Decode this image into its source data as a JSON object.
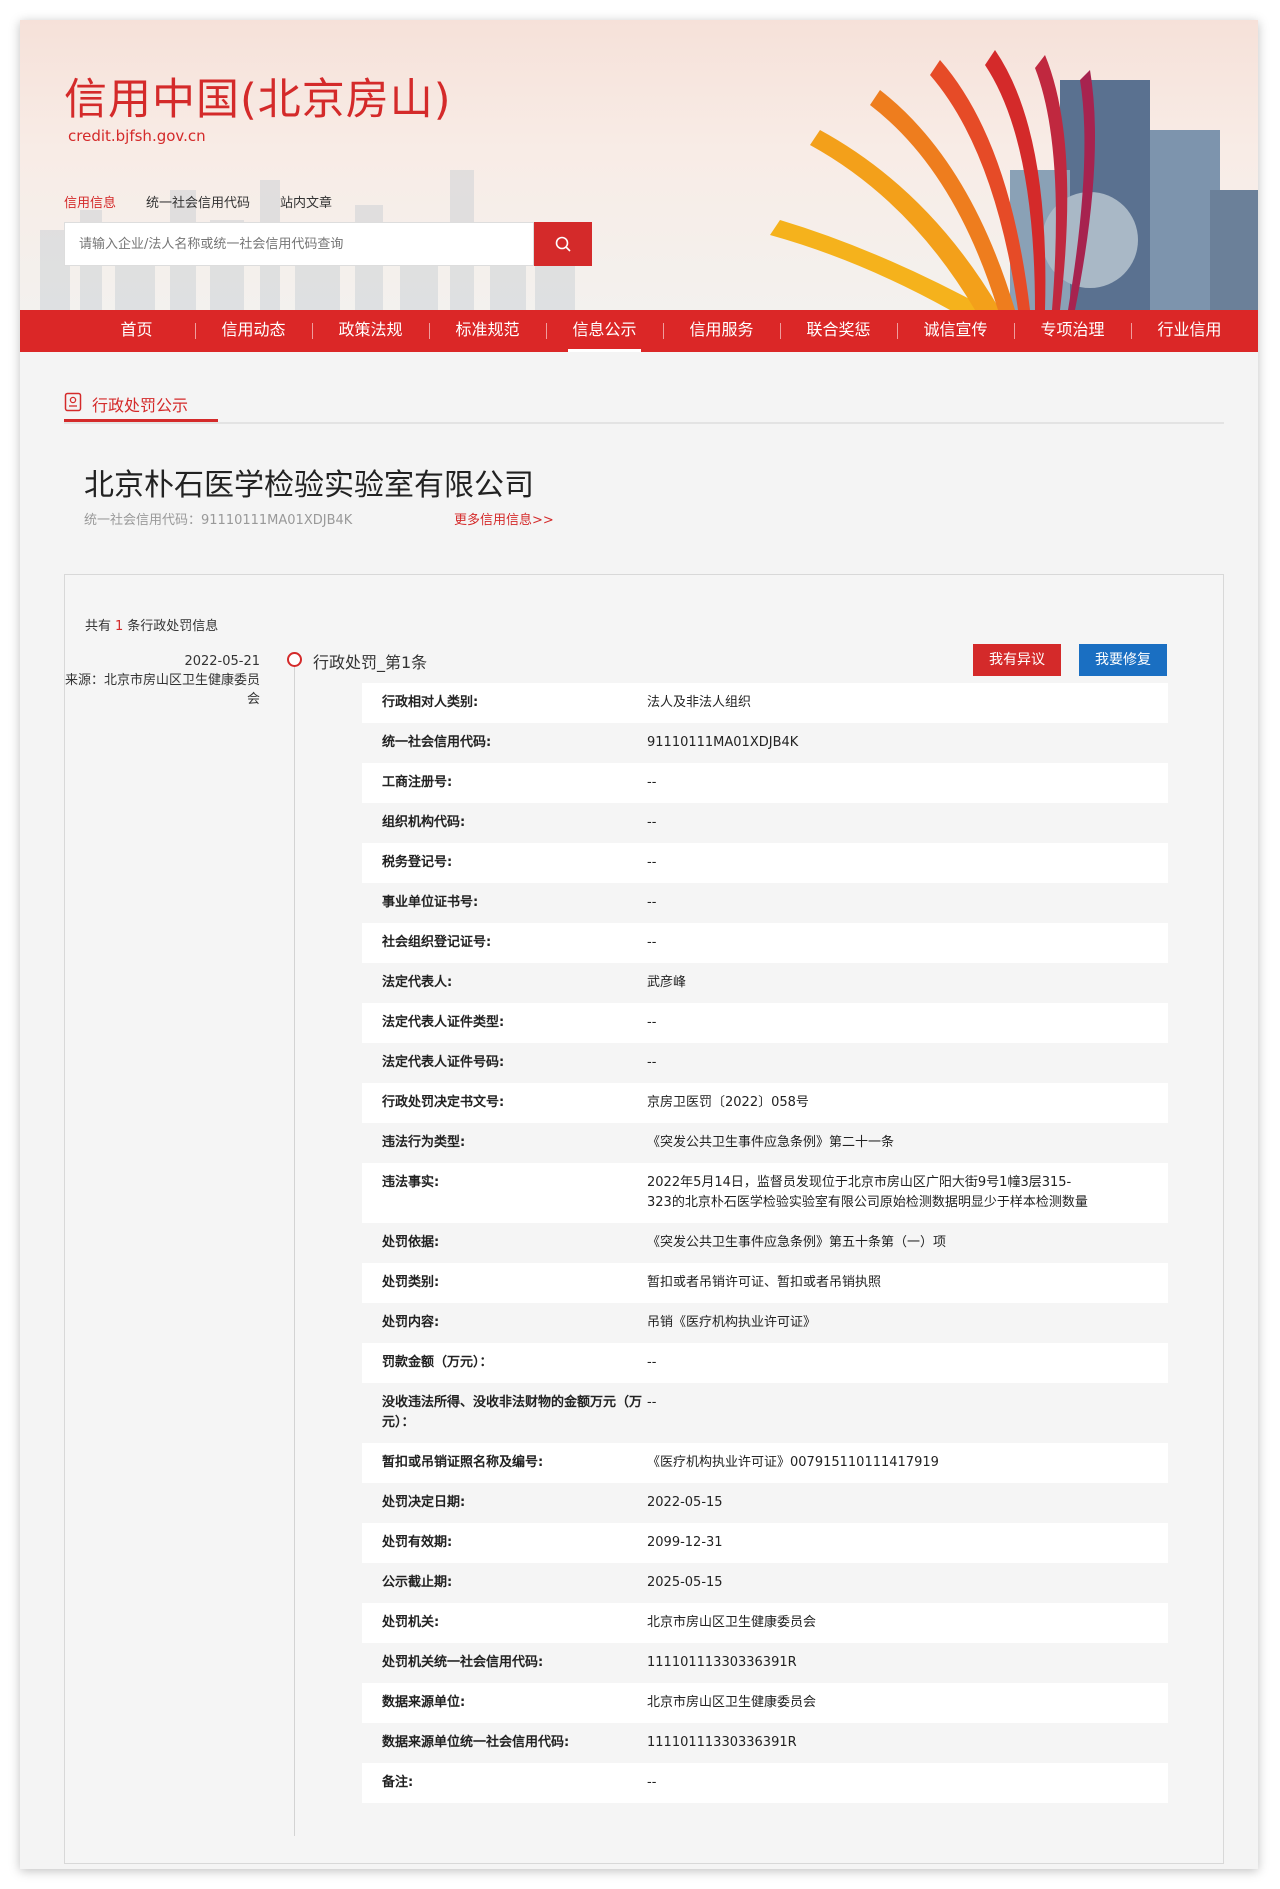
{
  "header": {
    "site_title": "信用中国(北京房山)",
    "site_url": "credit.bjfsh.gov.cn",
    "search_tabs": [
      "信用信息",
      "统一社会信用代码",
      "站内文章"
    ],
    "search_placeholder": "请输入企业/法人名称或统一社会信用代码查询"
  },
  "nav": {
    "items": [
      "首页",
      "信用动态",
      "政策法规",
      "标准规范",
      "信息公示",
      "信用服务",
      "联合奖惩",
      "诚信宣传",
      "专项治理",
      "行业信用"
    ],
    "active": "信息公示"
  },
  "section": {
    "title": "行政处罚公示"
  },
  "company": {
    "name": "北京朴石医学检验实验室有限公司",
    "uscc_line": "统一社会信用代码：91110111MA01XDJB4K",
    "more_link": "更多信用信息>>"
  },
  "records": {
    "total_prefix": "共有",
    "total_count": "1",
    "total_suffix": "条行政处罚信息",
    "date": "2022-05-21",
    "source": "来源：北京市房山区卫生健康委员会",
    "item_title": "行政处罚_第1条",
    "btn_objection": "我有异议",
    "btn_repair": "我要修复"
  },
  "details": [
    {
      "k": "行政相对人类别:",
      "v": "法人及非法人组织"
    },
    {
      "k": "统一社会信用代码:",
      "v": "91110111MA01XDJB4K"
    },
    {
      "k": "工商注册号:",
      "v": "--"
    },
    {
      "k": "组织机构代码:",
      "v": "--"
    },
    {
      "k": "税务登记号:",
      "v": "--"
    },
    {
      "k": "事业单位证书号:",
      "v": "--"
    },
    {
      "k": "社会组织登记证号:",
      "v": "--"
    },
    {
      "k": "法定代表人:",
      "v": "武彦峰"
    },
    {
      "k": "法定代表人证件类型:",
      "v": "--"
    },
    {
      "k": "法定代表人证件号码:",
      "v": "--"
    },
    {
      "k": "行政处罚决定书文号:",
      "v": "京房卫医罚〔2022〕058号"
    },
    {
      "k": "违法行为类型:",
      "v": "《突发公共卫生事件应急条例》第二十一条"
    },
    {
      "k": "违法事实:",
      "v": "2022年5月14日，监督员发现位于北京市房山区广阳大街9号1幢3层315-323的北京朴石医学检验实验室有限公司原始检测数据明显少于样本检测数量"
    },
    {
      "k": "处罚依据:",
      "v": "《突发公共卫生事件应急条例》第五十条第（一）项"
    },
    {
      "k": "处罚类别:",
      "v": "暂扣或者吊销许可证、暂扣或者吊销执照"
    },
    {
      "k": "处罚内容:",
      "v": "吊销《医疗机构执业许可证》"
    },
    {
      "k": "罚款金额（万元）：",
      "v": "--"
    },
    {
      "k": "没收违法所得、没收非法财物的金额万元（万元）：",
      "v": "--"
    },
    {
      "k": "暂扣或吊销证照名称及编号:",
      "v": "《医疗机构执业许可证》007915110111417919"
    },
    {
      "k": "处罚决定日期:",
      "v": "2022-05-15"
    },
    {
      "k": "处罚有效期:",
      "v": "2099-12-31"
    },
    {
      "k": "公示截止期:",
      "v": "2025-05-15"
    },
    {
      "k": "处罚机关:",
      "v": "北京市房山区卫生健康委员会"
    },
    {
      "k": "处罚机关统一社会信用代码:",
      "v": "11110111330336391R"
    },
    {
      "k": "数据来源单位:",
      "v": "北京市房山区卫生健康委员会"
    },
    {
      "k": "数据来源单位统一社会信用代码:",
      "v": "11110111330336391R"
    },
    {
      "k": "备注:",
      "v": "--"
    }
  ],
  "colors": {
    "brand_red": "#d42a2a",
    "nav_red": "#db2727",
    "repair_blue": "#1a6fc2"
  }
}
